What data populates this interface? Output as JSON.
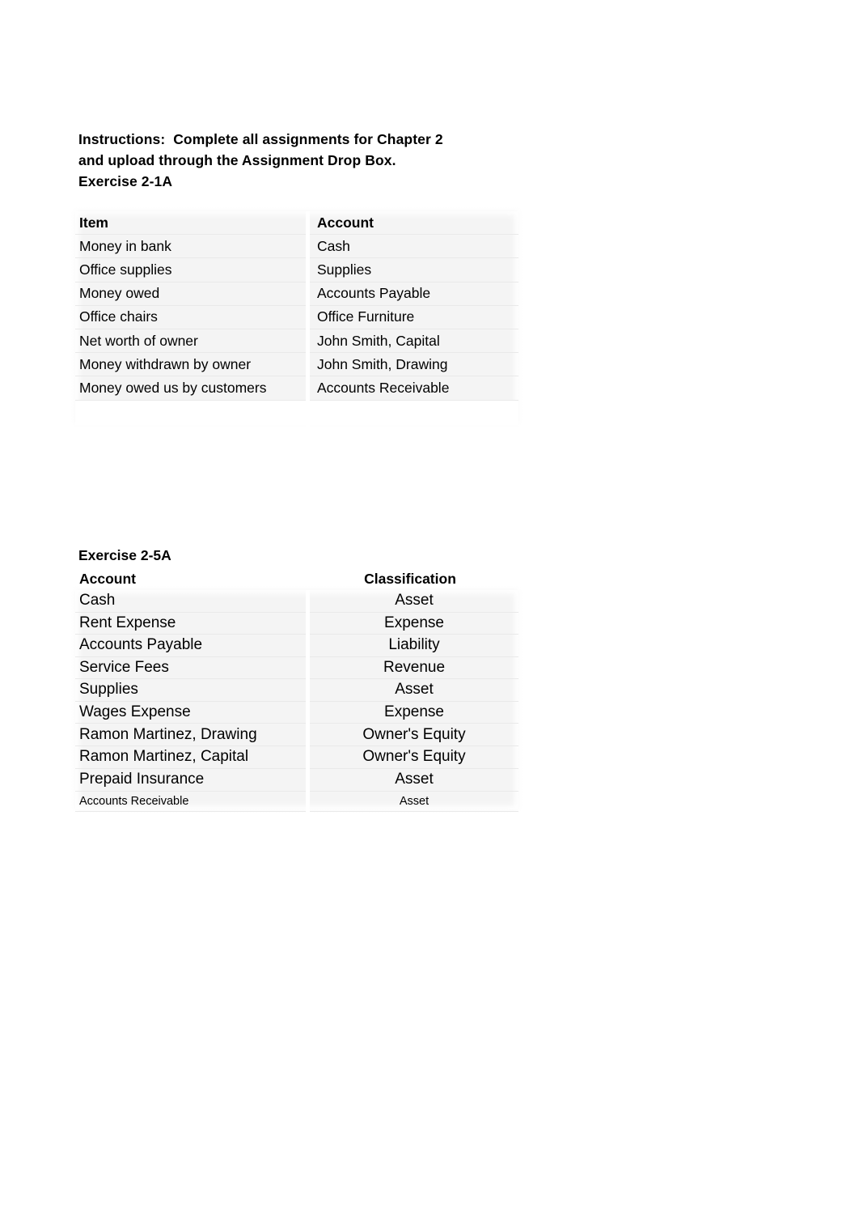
{
  "document": {
    "instructions": {
      "line1": "Instructions:  Complete all assignments for Chapter 2",
      "line2": "and upload through the Assignment Drop Box.",
      "line3": "Exercise 2-1A"
    },
    "exercise_2_1A": {
      "headers": [
        "Item",
        "Account"
      ],
      "rows": [
        [
          "Money in bank",
          "Cash"
        ],
        [
          "Office supplies",
          "Supplies"
        ],
        [
          "Money owed",
          "Accounts Payable"
        ],
        [
          "Office chairs",
          "Office Furniture"
        ],
        [
          "Net worth of owner",
          "John Smith, Capital"
        ],
        [
          "Money withdrawn by owner",
          "John Smith, Drawing"
        ],
        [
          "Money owed us by customers",
          "Accounts Receivable"
        ]
      ]
    },
    "exercise_2_5A": {
      "title": "Exercise 2-5A",
      "headers": [
        "Account",
        "Classification"
      ],
      "rows": [
        [
          "Cash",
          "Asset"
        ],
        [
          "Rent Expense",
          "Expense"
        ],
        [
          "Accounts Payable",
          "Liability"
        ],
        [
          "Service Fees",
          "Revenue"
        ],
        [
          "Supplies",
          "Asset"
        ],
        [
          "Wages Expense",
          "Expense"
        ],
        [
          "Ramon Martinez, Drawing",
          "Owner's Equity"
        ],
        [
          "Ramon Martinez, Capital",
          "Owner's Equity"
        ],
        [
          "Prepaid Insurance",
          "Asset"
        ],
        [
          "Accounts Receivable",
          "Asset"
        ]
      ]
    }
  }
}
